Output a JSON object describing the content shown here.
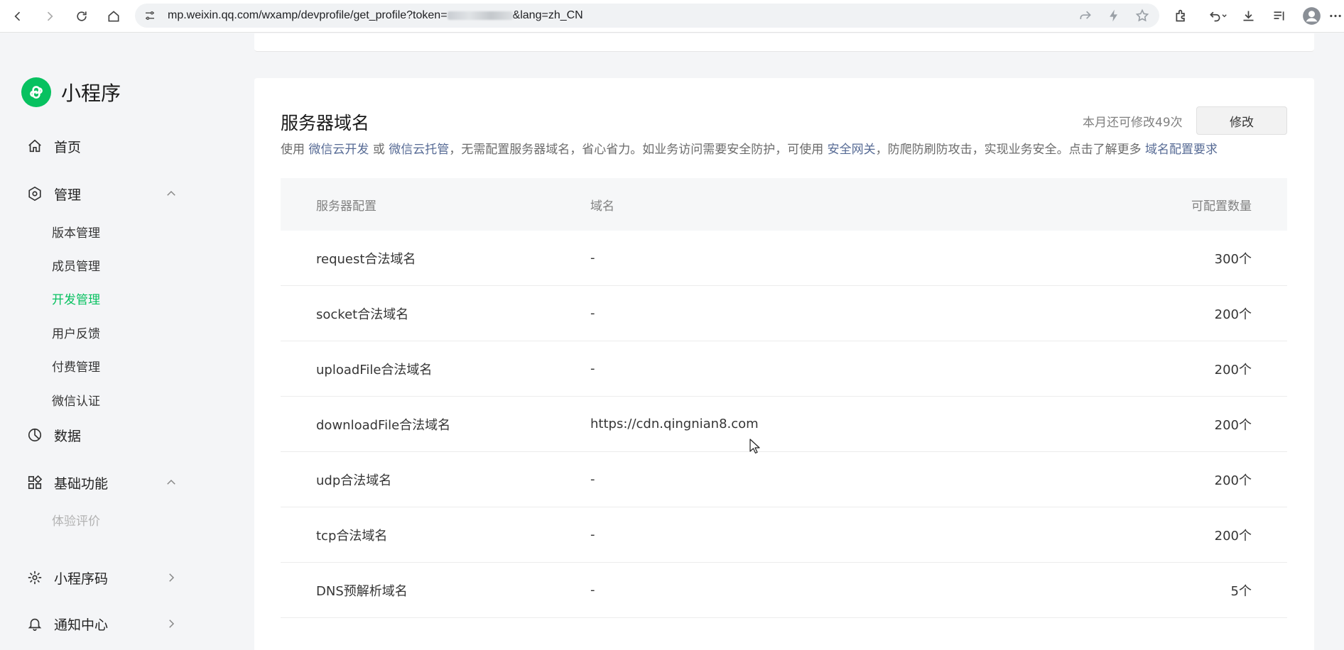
{
  "browser": {
    "url_prefix": "mp.weixin.qq.com/wxamp/devprofile/get_profile?token=",
    "url_suffix": "&lang=zh_CN"
  },
  "sidebar": {
    "brand": "小程序",
    "home": "首页",
    "manage": "管理",
    "manage_items": [
      "版本管理",
      "成员管理",
      "开发管理",
      "用户反馈",
      "付费管理",
      "微信认证"
    ],
    "data": "数据",
    "basic": "基础功能",
    "basic_items": [
      "体验评价"
    ],
    "qrcode": "小程序码",
    "notify": "通知中心"
  },
  "panel": {
    "title": "服务器域名",
    "desc_1": "使用",
    "link_1": "微信云开发",
    "desc_2": "或",
    "link_2": "微信云托管",
    "desc_3": "，无需配置服务器域名，省心省力。如业务访问需要安全防护，可使用",
    "link_3": "安全网关",
    "desc_4": "，防爬防刷防攻击，实现业务安全。点击了解更多",
    "link_4": "域名配置要求",
    "quota": "本月还可修改49次",
    "modify_label": "修改",
    "columns": [
      "服务器配置",
      "域名",
      "可配置数量"
    ],
    "rows": [
      {
        "config": "request合法域名",
        "domain": "-",
        "count": "300个"
      },
      {
        "config": "socket合法域名",
        "domain": "-",
        "count": "200个"
      },
      {
        "config": "uploadFile合法域名",
        "domain": "-",
        "count": "200个"
      },
      {
        "config": "downloadFile合法域名",
        "domain": "https://cdn.qingnian8.com",
        "count": "200个"
      },
      {
        "config": "udp合法域名",
        "domain": "-",
        "count": "200个"
      },
      {
        "config": "tcp合法域名",
        "domain": "-",
        "count": "200个"
      },
      {
        "config": "DNS预解析域名",
        "domain": "-",
        "count": "5个"
      }
    ]
  },
  "colors": {
    "accent": "#07c160",
    "link": "#576b95"
  }
}
